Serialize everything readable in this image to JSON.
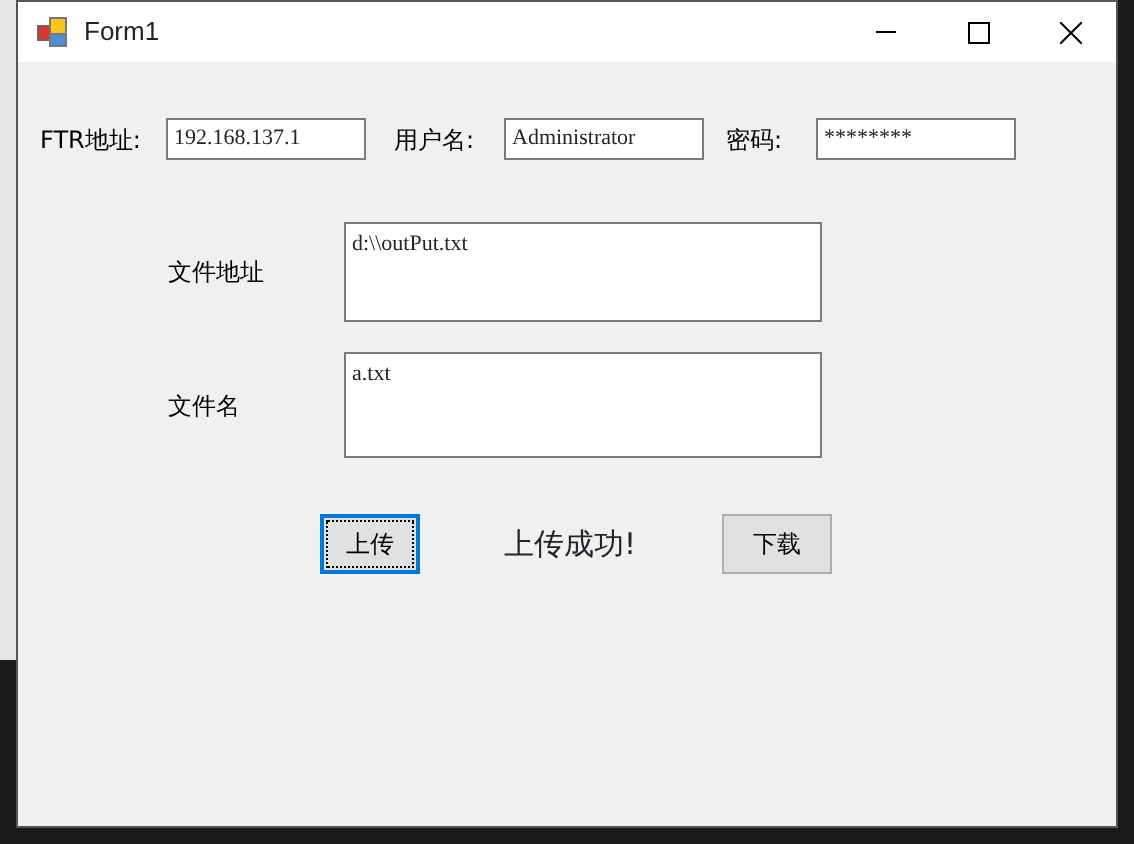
{
  "window": {
    "title": "Form1"
  },
  "connection": [
    {
      "label": "FTR地址:",
      "value": "192.168.137.1"
    },
    {
      "label": "用户名:",
      "value": "Administrator"
    },
    {
      "label": "密码:",
      "value": "********"
    }
  ],
  "files": [
    {
      "label": "文件地址",
      "value": "d:\\\\outPut.txt"
    },
    {
      "label": "文件名",
      "value": "a.txt"
    }
  ],
  "buttons": [
    {
      "label": "上传",
      "focused": true
    },
    {
      "label": "下载",
      "focused": false
    }
  ],
  "status": "上传成功!"
}
